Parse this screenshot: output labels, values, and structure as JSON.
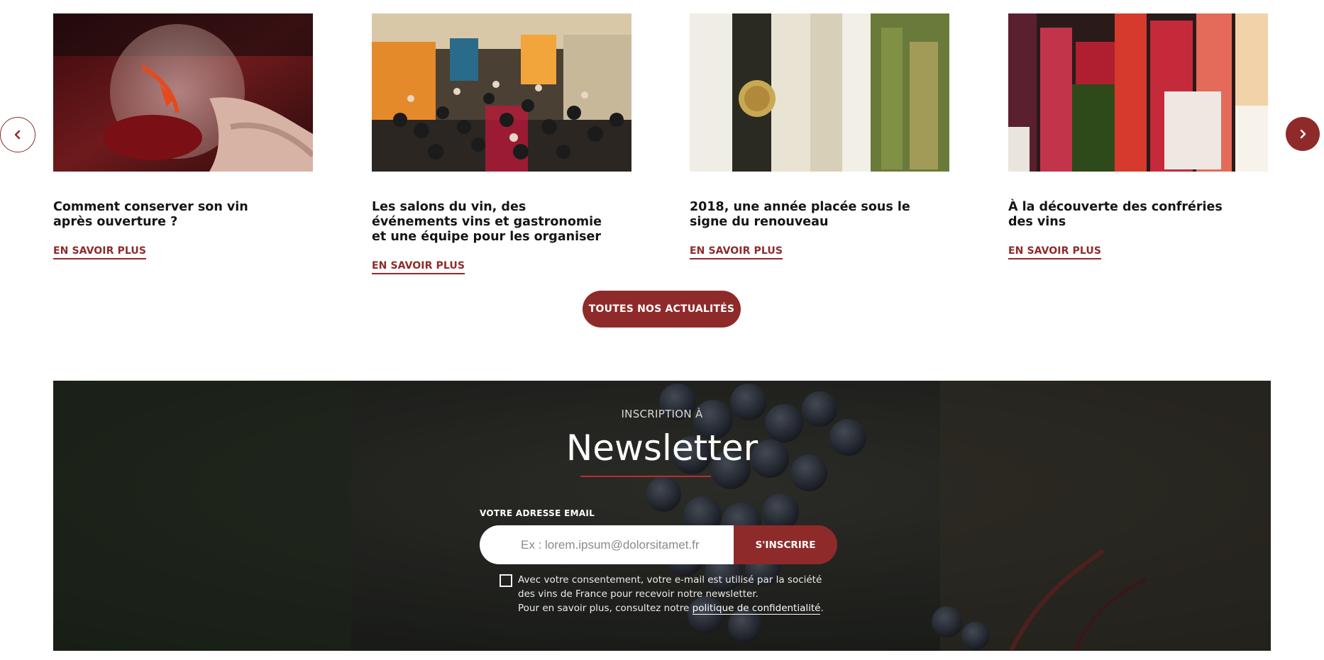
{
  "carousel": {
    "prev_icon": "chevron-left-icon",
    "next_icon": "chevron-right-icon",
    "cards": [
      {
        "title": "Comment conserver son vin après ouverture ?",
        "more": "EN SAVOIR PLUS",
        "image": "red-wine-glass-photo"
      },
      {
        "title": "Les salons du vin, des événements vins et gastronomie et une équipe pour les organiser",
        "more": "EN SAVOIR PLUS",
        "image": "wine-fair-crowd-photo"
      },
      {
        "title": "2018, une année placée sous le signe du renouveau",
        "more": "EN SAVOIR PLUS",
        "image": "wine-bottles-labels-photo"
      },
      {
        "title": "À la découverte des confréries des vins",
        "more": "EN SAVOIR PLUS",
        "image": "rose-wine-bottles-photo"
      }
    ],
    "all_news_label": "TOUTES NOS ACTUALITÉS"
  },
  "newsletter": {
    "kicker": "INSCRIPTION À",
    "title": "Newsletter",
    "email_label": "VOTRE ADRESSE EMAIL",
    "email_placeholder": "Ex : lorem.ipsum@dolorsitamet.fr",
    "email_value": "",
    "submit_label": "S'INSCRIRE",
    "consent_line1": "Avec votre consentement, votre e-mail est utilisé par la société des vins de France pour recevoir notre newsletter.",
    "consent_line2": "Pour en savoir plus, consultez notre ",
    "privacy_link": "politique de confidentialité",
    "privacy_suffix": ".",
    "background": "grape-vineyard-photo"
  },
  "colors": {
    "brand": "#8f2a2b",
    "accent_underline": "#b33030",
    "title_text": "#151515"
  }
}
